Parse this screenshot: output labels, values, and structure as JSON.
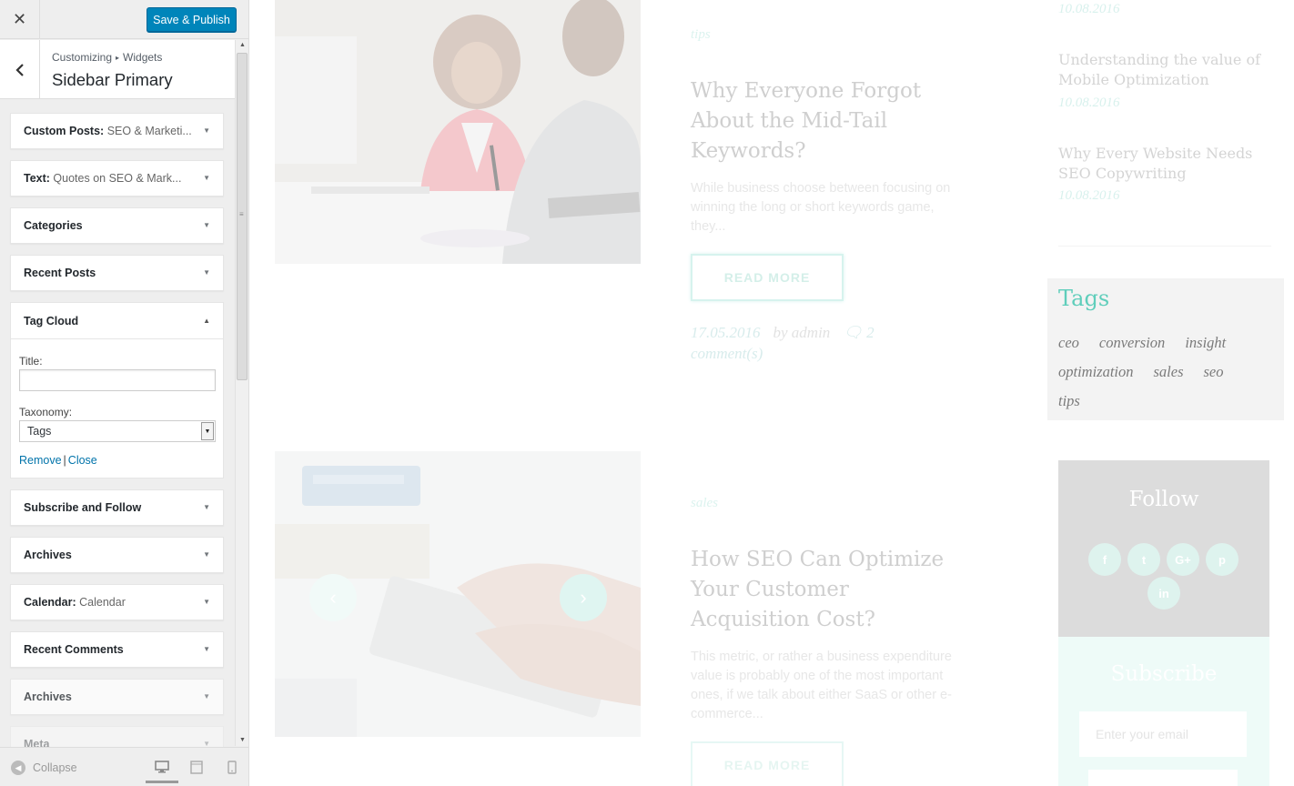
{
  "customizer": {
    "save_label": "Save & Publish",
    "breadcrumb": [
      "Customizing",
      "Widgets"
    ],
    "title": "Sidebar Primary",
    "widgets": [
      {
        "title": "Custom Posts",
        "subtitle": "SEO & Marketi..."
      },
      {
        "title": "Text",
        "subtitle": "Quotes on SEO & Mark..."
      },
      {
        "title": "Categories",
        "subtitle": ""
      },
      {
        "title": "Recent Posts",
        "subtitle": ""
      }
    ],
    "open_widget": {
      "title": "Tag Cloud",
      "title_label": "Title:",
      "title_value": "",
      "taxonomy_label": "Taxonomy:",
      "taxonomy_value": "Tags",
      "remove_label": "Remove",
      "close_label": "Close"
    },
    "widgets_after": [
      {
        "title": "Subscribe and Follow",
        "subtitle": ""
      },
      {
        "title": "Archives",
        "subtitle": ""
      },
      {
        "title": "Calendar",
        "subtitle": "Calendar"
      },
      {
        "title": "Recent Comments",
        "subtitle": ""
      },
      {
        "title": "Archives",
        "subtitle": ""
      },
      {
        "title": "Meta",
        "subtitle": ""
      }
    ],
    "collapse_label": "Collapse"
  },
  "preview": {
    "posts": [
      {
        "category": "tips",
        "title": "Why Everyone Forgot About the Mid-Tail Keywords?",
        "excerpt": "While business choose between focusing on winning the long or short keywords game, they...",
        "read_more": "READ MORE",
        "date": "17.05.2016",
        "author": "by admin",
        "comments": "2 comment(s)"
      },
      {
        "category": "sales",
        "title": "How SEO Can Optimize Your Customer Acquisition Cost?",
        "excerpt": "This metric, or rather a business expenditure value is probably one of the most important ones, if we talk about either SaaS or other e-commerce...",
        "read_more": "READ MORE"
      }
    ],
    "sidebar_posts": [
      {
        "title": "",
        "date": "10.08.2016"
      },
      {
        "title": "Understanding the value of Mobile Optimization",
        "date": "10.08.2016"
      },
      {
        "title": "Why Every Website Needs SEO Copywriting",
        "date": "10.08.2016"
      }
    ],
    "tags_title": "Tags",
    "tags": [
      "ceo",
      "conversion",
      "insight",
      "optimization",
      "sales",
      "seo",
      "tips"
    ],
    "follow_title": "Follow",
    "social": [
      "f",
      "t",
      "G+",
      "p",
      "in"
    ],
    "subscribe_title": "Subscribe",
    "email_placeholder": "Enter your email"
  },
  "colors": {
    "accent": "#0085ba",
    "link": "#0073aa",
    "theme": "#5fcebb"
  }
}
